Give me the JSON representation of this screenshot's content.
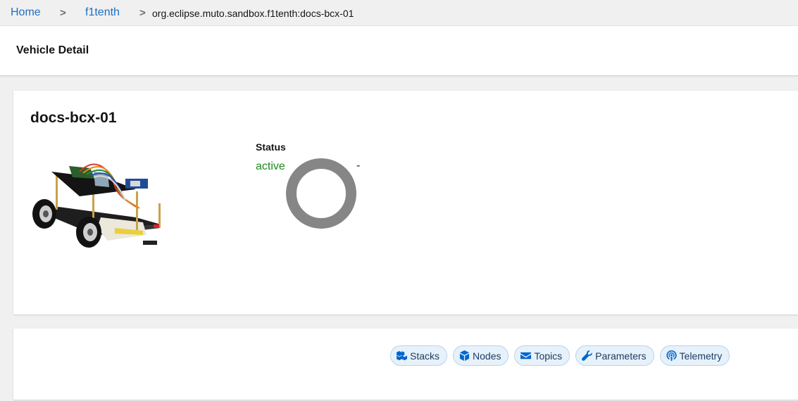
{
  "breadcrumb": {
    "items": [
      {
        "label": "Home"
      },
      {
        "label": "f1tenth"
      }
    ],
    "current": "org.eclipse.muto.sandbox.f1tenth:docs-bcx-01",
    "separator": ">"
  },
  "header": {
    "title": "Vehicle Detail"
  },
  "vehicle": {
    "name": "docs-bcx-01",
    "status_label": "Status",
    "status_value": "active",
    "secondary_value": "-"
  },
  "tabs": [
    {
      "label": "Stacks",
      "icon": "cubes-icon"
    },
    {
      "label": "Nodes",
      "icon": "cube-icon"
    },
    {
      "label": "Topics",
      "icon": "envelope-icon"
    },
    {
      "label": "Parameters",
      "icon": "wrench-icon"
    },
    {
      "label": "Telemetry",
      "icon": "podcast-icon"
    }
  ],
  "colors": {
    "link": "#1f6fc4",
    "status_active": "#1e8a1e",
    "tab_background": "#e7f1fa",
    "tab_icon": "#0066cc",
    "spinner": "#868686"
  }
}
